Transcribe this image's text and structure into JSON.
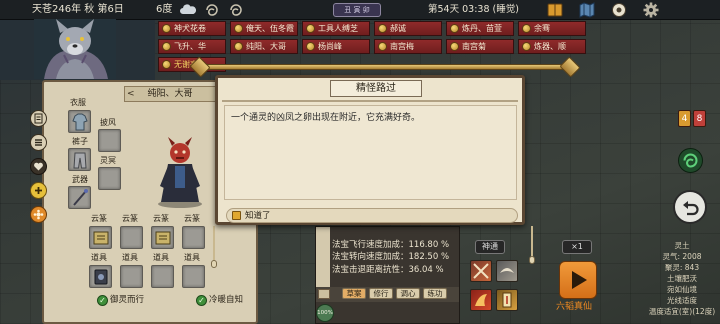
{
  "topbar": {
    "date": "天苍246年 秋 第6日",
    "temperature": "6度",
    "time_badge": "丑 寅 卯",
    "day_time": "第54天 03:38 (睡觉)"
  },
  "name_tags": [
    {
      "label": "神犬花卷"
    },
    {
      "label": "俺天、伍冬霞"
    },
    {
      "label": "工具人缚芝"
    },
    {
      "label": "郝诚"
    },
    {
      "label": "炼丹、苗萱"
    },
    {
      "label": "余骞"
    },
    {
      "label": "飞升、华"
    },
    {
      "label": "纯阳、大哥"
    },
    {
      "label": "杨尚峰"
    },
    {
      "label": "南宫梅"
    },
    {
      "label": "南宫菊"
    },
    {
      "label": "炼器、顺"
    },
    {
      "label": "无谢亭"
    }
  ],
  "character_panel": {
    "title": "纯阳、大哥",
    "nav_prev": "<",
    "equip_labels": {
      "clothes": "衣服",
      "cape": "披风",
      "pants": "裤子",
      "spirit": "灵冥",
      "weapon": "武器"
    },
    "rune_labels": [
      "云篆",
      "云篆",
      "云篆",
      "云篆"
    ],
    "tool_labels": [
      "道具",
      "道具",
      "道具",
      "道具"
    ],
    "traits": [
      "御灵而行",
      "冷暖自知"
    ]
  },
  "dialog": {
    "title": "精怪路过",
    "message": "一个通灵的凶凤之卵出现在附近，它充满好奇。",
    "ok_label": "知道了"
  },
  "artifact_stats": {
    "lines": [
      "法宝飞行速度加成：116.80 %",
      "法宝转向速度加成：182.50 %",
      "法宝击退距离抗性：36.04 %"
    ],
    "tabs": [
      "草案",
      "修行",
      "调心",
      "练功"
    ],
    "active_tab": "草案",
    "percent": "100%"
  },
  "controls": {
    "shentong_label": "神通",
    "speed_label": "×1",
    "skill_name": "六韬真仙"
  },
  "counters": {
    "yellow": "4",
    "red": "8"
  },
  "tile_info": [
    "灵土",
    "灵气: 2008",
    "聚灵: 843",
    "土壤肥沃",
    "宛如仙境",
    "光线适度",
    "温度适宜(室)(12度)"
  ],
  "icons": {
    "topbar": [
      "cloud-icon",
      "swirl-icon",
      "swirl-icon",
      "book-icon",
      "map-icon",
      "compass-icon",
      "gear-icon"
    ],
    "sidebar": [
      "document-icon",
      "list-icon",
      "heart-icon",
      "plus-icon",
      "flower-gear-icon"
    ],
    "right": [
      "green-swirl-icon",
      "back-arrow-icon",
      "play-icon"
    ]
  },
  "colors": {
    "tag_red": "#8f2a2a",
    "parchment": "#ede4cd",
    "accent_orange": "#f08a20",
    "check_green": "#3f8f3a"
  }
}
